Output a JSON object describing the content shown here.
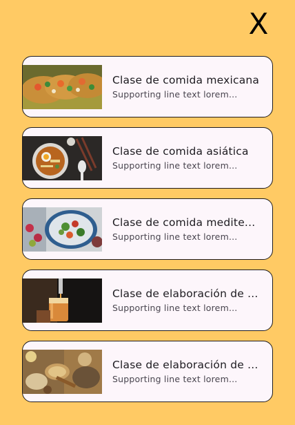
{
  "close_label": "X",
  "items": [
    {
      "title": "Clase de comida mexicana",
      "subtitle": "Supporting line text lorem..."
    },
    {
      "title": "Clase de comida asiática",
      "subtitle": "Supporting line text lorem..."
    },
    {
      "title": "Clase de comida medite...",
      "subtitle": "Supporting line text lorem..."
    },
    {
      "title": "Clase de elaboración de ...",
      "subtitle": "Supporting line text lorem..."
    },
    {
      "title": "Clase de elaboración de ...",
      "subtitle": "Supporting line text lorem..."
    }
  ],
  "colors": {
    "background": "#FFCA64",
    "card": "#FDF6FB",
    "border": "#1D1B1E"
  }
}
